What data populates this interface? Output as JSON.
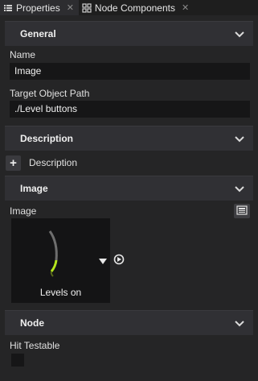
{
  "tabs": [
    {
      "label": "Properties",
      "icon": "list-icon",
      "active": true
    },
    {
      "label": "Node Components",
      "icon": "node-components-icon",
      "active": false
    }
  ],
  "sections": {
    "general": {
      "title": "General",
      "name_label": "Name",
      "name_value": "Image",
      "path_label": "Target Object Path",
      "path_value": "./Level buttons"
    },
    "description": {
      "title": "Description",
      "add_label": "Description"
    },
    "image": {
      "title": "Image",
      "image_label": "Image",
      "thumbnail_caption": "Levels on"
    },
    "node": {
      "title": "Node",
      "hit_testable_label": "Hit Testable",
      "hit_testable_checked": false
    }
  },
  "colors": {
    "background": "#252526",
    "header": "#303034",
    "field": "#161617",
    "accent_green": "#b5e61d"
  }
}
